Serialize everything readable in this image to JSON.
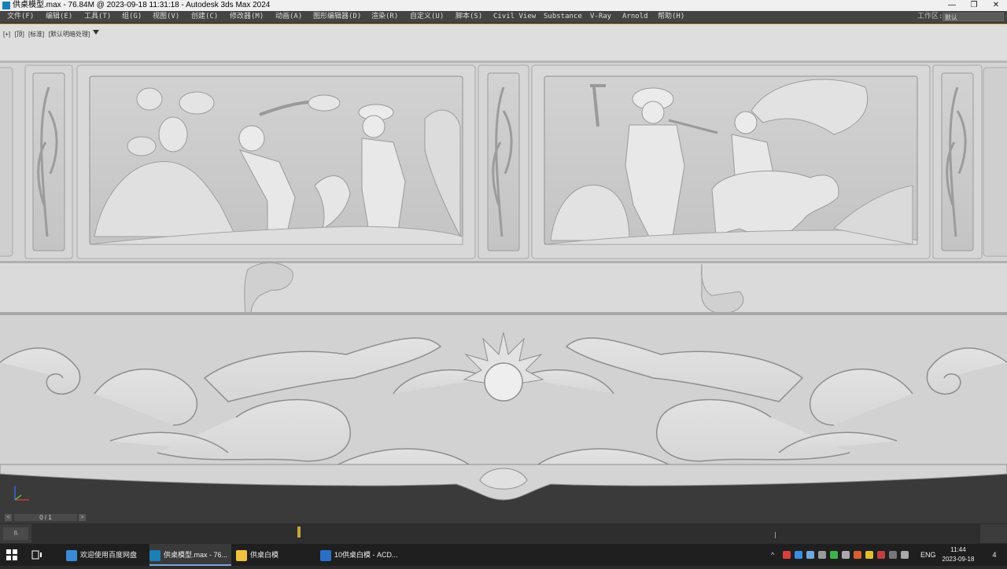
{
  "window": {
    "title": "供桌模型.max - 76.84M @ 2023-09-18 11:31:18 - Autodesk 3ds Max 2024",
    "minimize": "—",
    "restore": "❐",
    "close": "✕"
  },
  "menu": {
    "items": [
      "文件(F)",
      "编辑(E)",
      "工具(T)",
      "组(G)",
      "视图(V)",
      "创建(C)",
      "修改器(M)",
      "动画(A)",
      "图形编辑器(D)",
      "渲染(R)",
      "自定义(U)",
      "脚本(S)",
      "Civil View",
      "Substance",
      "V-Ray",
      "Arnold",
      "帮助(H)"
    ],
    "workspace_label": "工作区:",
    "workspace_value": "默认"
  },
  "viewport": {
    "labels": [
      "[+]",
      "[顶]",
      "[标准]",
      "[默认明暗处理]"
    ]
  },
  "timeline": {
    "frame_display": "0 / 1",
    "prev": "<",
    "next": ">",
    "key_mode": "I\\"
  },
  "taskbar": {
    "items": [
      {
        "label": "欢迎使用百度网盘",
        "color": "#3b8ad8"
      },
      {
        "label": "供桌模型.max - 76...",
        "color": "#1a7fb5"
      },
      {
        "label": "供桌白模",
        "color": "#f0c040"
      },
      {
        "label": "10供桌白模 - ACD...",
        "color": "#2a6fc4"
      }
    ],
    "lang": "ENG",
    "time": "11:44",
    "date": "2023-09-18",
    "notifications": "4"
  },
  "colors": {
    "viewport_bg": "#dcdcdc",
    "relief": "#e8e8e8",
    "dark_base": "#3a3a3a",
    "accent": "#c9a93a"
  }
}
